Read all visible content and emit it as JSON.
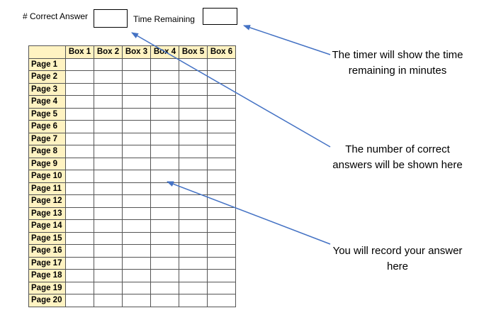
{
  "header": {
    "correct_label": "# Correct Answer",
    "correct_value": "",
    "time_label": "Time Remaining",
    "time_value": ""
  },
  "table": {
    "corner": "",
    "columns": [
      "Box 1",
      "Box 2",
      "Box 3",
      "Box 4",
      "Box 5",
      "Box 6"
    ],
    "rows": [
      "Page 1",
      "Page 2",
      "Page 3",
      "Page 4",
      "Page 5",
      "Page 6",
      "Page 7",
      "Page 8",
      "Page 9",
      "Page 10",
      "Page 11",
      "Page 12",
      "Page 13",
      "Page 14",
      "Page 15",
      "Page 16",
      "Page 17",
      "Page 18",
      "Page 19",
      "Page 20"
    ],
    "header_fill": "#fff3c2"
  },
  "annotations": {
    "timer_note": "The timer will show the time remaining in minutes",
    "correct_note": "The number of correct answers will be shown here",
    "record_note": "You will record your answer here",
    "arrow_color": "#4472c4"
  }
}
